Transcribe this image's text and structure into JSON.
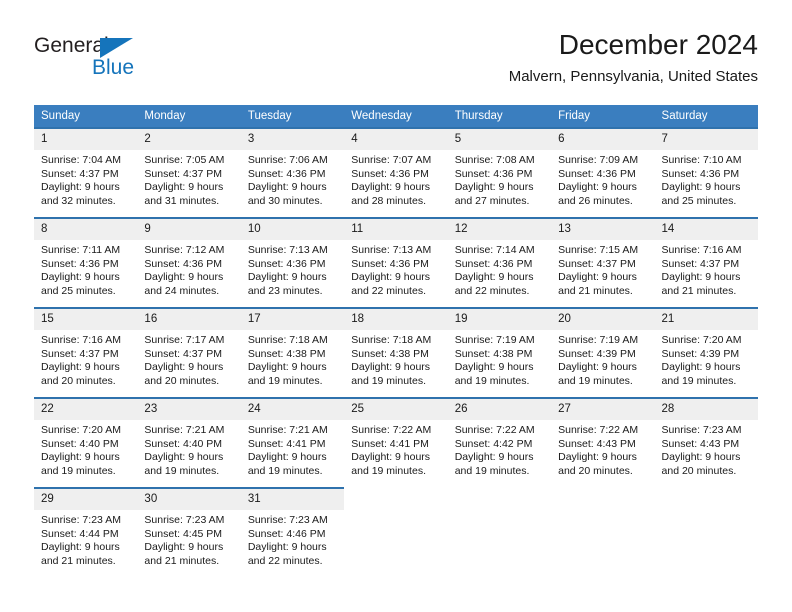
{
  "brand": {
    "name_part1": "General",
    "name_part2": "Blue",
    "triangle_color": "#1574bb",
    "text_color": "#231f20"
  },
  "header": {
    "title": "December 2024",
    "subtitle": "Malvern, Pennsylvania, United States"
  },
  "theme": {
    "header_row_bg": "#3a7ebf",
    "row_divider": "#2f72ad",
    "day_band_bg": "#efefef",
    "text": "#1a1a1a"
  },
  "calendar": {
    "weekday_headers": [
      "Sunday",
      "Monday",
      "Tuesday",
      "Wednesday",
      "Thursday",
      "Friday",
      "Saturday"
    ],
    "weeks": [
      [
        {
          "day": "1",
          "sunrise": "Sunrise: 7:04 AM",
          "sunset": "Sunset: 4:37 PM",
          "daylight1": "Daylight: 9 hours",
          "daylight2": "and 32 minutes."
        },
        {
          "day": "2",
          "sunrise": "Sunrise: 7:05 AM",
          "sunset": "Sunset: 4:37 PM",
          "daylight1": "Daylight: 9 hours",
          "daylight2": "and 31 minutes."
        },
        {
          "day": "3",
          "sunrise": "Sunrise: 7:06 AM",
          "sunset": "Sunset: 4:36 PM",
          "daylight1": "Daylight: 9 hours",
          "daylight2": "and 30 minutes."
        },
        {
          "day": "4",
          "sunrise": "Sunrise: 7:07 AM",
          "sunset": "Sunset: 4:36 PM",
          "daylight1": "Daylight: 9 hours",
          "daylight2": "and 28 minutes."
        },
        {
          "day": "5",
          "sunrise": "Sunrise: 7:08 AM",
          "sunset": "Sunset: 4:36 PM",
          "daylight1": "Daylight: 9 hours",
          "daylight2": "and 27 minutes."
        },
        {
          "day": "6",
          "sunrise": "Sunrise: 7:09 AM",
          "sunset": "Sunset: 4:36 PM",
          "daylight1": "Daylight: 9 hours",
          "daylight2": "and 26 minutes."
        },
        {
          "day": "7",
          "sunrise": "Sunrise: 7:10 AM",
          "sunset": "Sunset: 4:36 PM",
          "daylight1": "Daylight: 9 hours",
          "daylight2": "and 25 minutes."
        }
      ],
      [
        {
          "day": "8",
          "sunrise": "Sunrise: 7:11 AM",
          "sunset": "Sunset: 4:36 PM",
          "daylight1": "Daylight: 9 hours",
          "daylight2": "and 25 minutes."
        },
        {
          "day": "9",
          "sunrise": "Sunrise: 7:12 AM",
          "sunset": "Sunset: 4:36 PM",
          "daylight1": "Daylight: 9 hours",
          "daylight2": "and 24 minutes."
        },
        {
          "day": "10",
          "sunrise": "Sunrise: 7:13 AM",
          "sunset": "Sunset: 4:36 PM",
          "daylight1": "Daylight: 9 hours",
          "daylight2": "and 23 minutes."
        },
        {
          "day": "11",
          "sunrise": "Sunrise: 7:13 AM",
          "sunset": "Sunset: 4:36 PM",
          "daylight1": "Daylight: 9 hours",
          "daylight2": "and 22 minutes."
        },
        {
          "day": "12",
          "sunrise": "Sunrise: 7:14 AM",
          "sunset": "Sunset: 4:36 PM",
          "daylight1": "Daylight: 9 hours",
          "daylight2": "and 22 minutes."
        },
        {
          "day": "13",
          "sunrise": "Sunrise: 7:15 AM",
          "sunset": "Sunset: 4:37 PM",
          "daylight1": "Daylight: 9 hours",
          "daylight2": "and 21 minutes."
        },
        {
          "day": "14",
          "sunrise": "Sunrise: 7:16 AM",
          "sunset": "Sunset: 4:37 PM",
          "daylight1": "Daylight: 9 hours",
          "daylight2": "and 21 minutes."
        }
      ],
      [
        {
          "day": "15",
          "sunrise": "Sunrise: 7:16 AM",
          "sunset": "Sunset: 4:37 PM",
          "daylight1": "Daylight: 9 hours",
          "daylight2": "and 20 minutes."
        },
        {
          "day": "16",
          "sunrise": "Sunrise: 7:17 AM",
          "sunset": "Sunset: 4:37 PM",
          "daylight1": "Daylight: 9 hours",
          "daylight2": "and 20 minutes."
        },
        {
          "day": "17",
          "sunrise": "Sunrise: 7:18 AM",
          "sunset": "Sunset: 4:38 PM",
          "daylight1": "Daylight: 9 hours",
          "daylight2": "and 19 minutes."
        },
        {
          "day": "18",
          "sunrise": "Sunrise: 7:18 AM",
          "sunset": "Sunset: 4:38 PM",
          "daylight1": "Daylight: 9 hours",
          "daylight2": "and 19 minutes."
        },
        {
          "day": "19",
          "sunrise": "Sunrise: 7:19 AM",
          "sunset": "Sunset: 4:38 PM",
          "daylight1": "Daylight: 9 hours",
          "daylight2": "and 19 minutes."
        },
        {
          "day": "20",
          "sunrise": "Sunrise: 7:19 AM",
          "sunset": "Sunset: 4:39 PM",
          "daylight1": "Daylight: 9 hours",
          "daylight2": "and 19 minutes."
        },
        {
          "day": "21",
          "sunrise": "Sunrise: 7:20 AM",
          "sunset": "Sunset: 4:39 PM",
          "daylight1": "Daylight: 9 hours",
          "daylight2": "and 19 minutes."
        }
      ],
      [
        {
          "day": "22",
          "sunrise": "Sunrise: 7:20 AM",
          "sunset": "Sunset: 4:40 PM",
          "daylight1": "Daylight: 9 hours",
          "daylight2": "and 19 minutes."
        },
        {
          "day": "23",
          "sunrise": "Sunrise: 7:21 AM",
          "sunset": "Sunset: 4:40 PM",
          "daylight1": "Daylight: 9 hours",
          "daylight2": "and 19 minutes."
        },
        {
          "day": "24",
          "sunrise": "Sunrise: 7:21 AM",
          "sunset": "Sunset: 4:41 PM",
          "daylight1": "Daylight: 9 hours",
          "daylight2": "and 19 minutes."
        },
        {
          "day": "25",
          "sunrise": "Sunrise: 7:22 AM",
          "sunset": "Sunset: 4:41 PM",
          "daylight1": "Daylight: 9 hours",
          "daylight2": "and 19 minutes."
        },
        {
          "day": "26",
          "sunrise": "Sunrise: 7:22 AM",
          "sunset": "Sunset: 4:42 PM",
          "daylight1": "Daylight: 9 hours",
          "daylight2": "and 19 minutes."
        },
        {
          "day": "27",
          "sunrise": "Sunrise: 7:22 AM",
          "sunset": "Sunset: 4:43 PM",
          "daylight1": "Daylight: 9 hours",
          "daylight2": "and 20 minutes."
        },
        {
          "day": "28",
          "sunrise": "Sunrise: 7:23 AM",
          "sunset": "Sunset: 4:43 PM",
          "daylight1": "Daylight: 9 hours",
          "daylight2": "and 20 minutes."
        }
      ],
      [
        {
          "day": "29",
          "sunrise": "Sunrise: 7:23 AM",
          "sunset": "Sunset: 4:44 PM",
          "daylight1": "Daylight: 9 hours",
          "daylight2": "and 21 minutes."
        },
        {
          "day": "30",
          "sunrise": "Sunrise: 7:23 AM",
          "sunset": "Sunset: 4:45 PM",
          "daylight1": "Daylight: 9 hours",
          "daylight2": "and 21 minutes."
        },
        {
          "day": "31",
          "sunrise": "Sunrise: 7:23 AM",
          "sunset": "Sunset: 4:46 PM",
          "daylight1": "Daylight: 9 hours",
          "daylight2": "and 22 minutes."
        },
        {
          "day": "",
          "sunrise": "",
          "sunset": "",
          "daylight1": "",
          "daylight2": ""
        },
        {
          "day": "",
          "sunrise": "",
          "sunset": "",
          "daylight1": "",
          "daylight2": ""
        },
        {
          "day": "",
          "sunrise": "",
          "sunset": "",
          "daylight1": "",
          "daylight2": ""
        },
        {
          "day": "",
          "sunrise": "",
          "sunset": "",
          "daylight1": "",
          "daylight2": ""
        }
      ]
    ]
  }
}
